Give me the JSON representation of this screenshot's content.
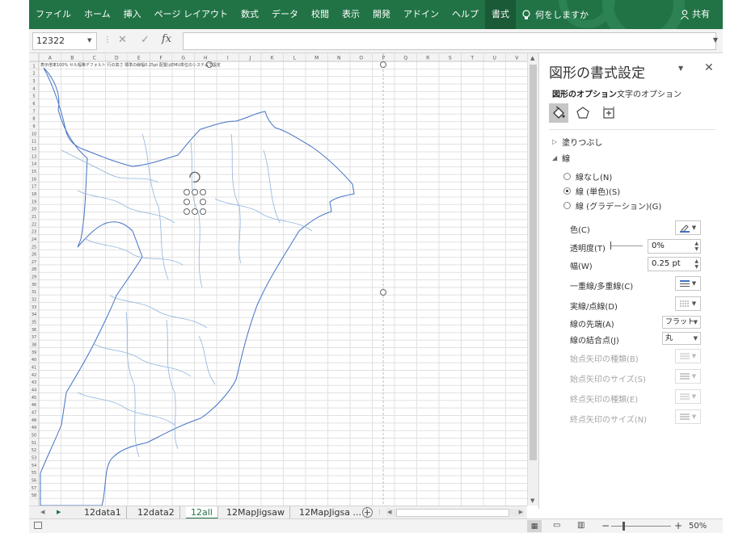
{
  "ribbon": {
    "tabs": [
      "ファイル",
      "ホーム",
      "挿入",
      "ページ レイアウト",
      "数式",
      "データ",
      "校閲",
      "表示",
      "開発",
      "アドイン",
      "ヘルプ",
      "書式"
    ],
    "active_tab": "書式",
    "tell_me": "何をしますか",
    "share": "共有",
    "colors": {
      "ribbon": "#217346"
    }
  },
  "formula_bar": {
    "name_box": "12322",
    "fx": "fx",
    "formula": ""
  },
  "sheet": {
    "column_headers": [
      "A",
      "B",
      "C",
      "D",
      "E",
      "F",
      "G",
      "H",
      "I",
      "J",
      "K",
      "L",
      "M",
      "N",
      "O",
      "P",
      "Q",
      "R",
      "S",
      "T",
      "U",
      "V"
    ],
    "row_count": 58,
    "header_note": "表示倍率100% セル幅等デフォルト 行の高さ 標準の線幅0.25pt 配置はEMU単位のシステムで設定"
  },
  "format_pane": {
    "title": "図形の書式設定",
    "tabs": {
      "shape_options": "図形のオプション",
      "text_options": "文字のオプション"
    },
    "sections": {
      "fill": "塗りつぶし",
      "line": "線"
    },
    "line_type": {
      "options": [
        "線なし(N)",
        "線 (単色)(S)",
        "線 (グラデーション)(G)"
      ],
      "selected": "線 (単色)(S)"
    },
    "properties": {
      "color": "色(C)",
      "transparency": "透明度(T)",
      "transparency_value": "0%",
      "width": "幅(W)",
      "width_value": "0.25 pt",
      "compound": "一重線/多重線(C)",
      "dash": "実線/点線(D)",
      "cap": "線の先端(A)",
      "cap_value": "フラット",
      "join": "線の結合点(J)",
      "join_value": "丸",
      "begin_arrow_type": "始点矢印の種類(B)",
      "begin_arrow_size": "始点矢印のサイズ(S)",
      "end_arrow_type": "終点矢印の種類(E)",
      "end_arrow_size": "終点矢印のサイズ(N)"
    },
    "line_color": "#4472c4"
  },
  "sheet_tabs": {
    "tabs": [
      "12data1",
      "12data2",
      "12all",
      "12MapJigsaw",
      "12MapJigsa ..."
    ],
    "active": "12all"
  },
  "status_bar": {
    "zoom": "50%",
    "zoom_percent": 50
  }
}
